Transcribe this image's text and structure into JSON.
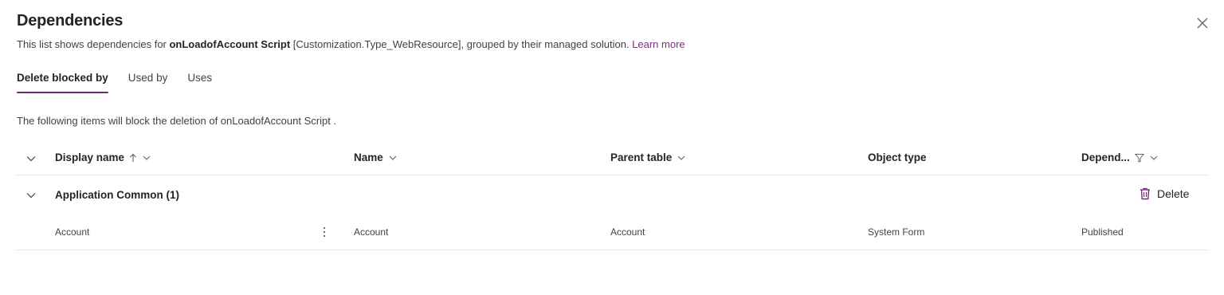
{
  "dialog": {
    "title": "Dependencies",
    "description_prefix": "This list shows dependencies for ",
    "component_name": "onLoadofAccount Script",
    "description_suffix": " [Customization.Type_WebResource], grouped by their managed solution. ",
    "learn_more": "Learn more"
  },
  "tabs": [
    {
      "label": "Delete blocked by",
      "active": true
    },
    {
      "label": "Used by",
      "active": false
    },
    {
      "label": "Uses",
      "active": false
    }
  ],
  "info_text": "The following items will block the deletion of onLoadofAccount Script .",
  "columns": {
    "display_name": "Display name",
    "name": "Name",
    "parent_table": "Parent table",
    "object_type": "Object type",
    "dependency": "Depend..."
  },
  "group": {
    "label": "Application Common (1)",
    "delete_label": "Delete"
  },
  "rows": [
    {
      "display_name": "Account",
      "name": "Account",
      "parent_table": "Account",
      "object_type": "System Form",
      "dependency": "Published"
    }
  ],
  "colors": {
    "accent": "#6b2a6c",
    "link": "#8a2a8b",
    "delete_icon": "#7a2a7b"
  }
}
